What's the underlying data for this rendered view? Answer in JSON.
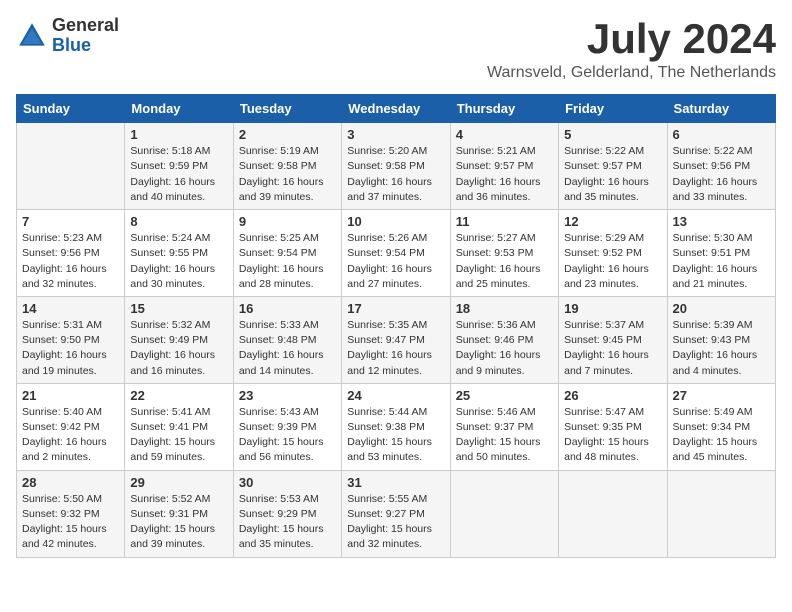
{
  "header": {
    "logo_general": "General",
    "logo_blue": "Blue",
    "month": "July 2024",
    "location": "Warnsveld, Gelderland, The Netherlands"
  },
  "weekdays": [
    "Sunday",
    "Monday",
    "Tuesday",
    "Wednesday",
    "Thursday",
    "Friday",
    "Saturday"
  ],
  "weeks": [
    [
      {
        "day": "",
        "info": ""
      },
      {
        "day": "1",
        "info": "Sunrise: 5:18 AM\nSunset: 9:59 PM\nDaylight: 16 hours\nand 40 minutes."
      },
      {
        "day": "2",
        "info": "Sunrise: 5:19 AM\nSunset: 9:58 PM\nDaylight: 16 hours\nand 39 minutes."
      },
      {
        "day": "3",
        "info": "Sunrise: 5:20 AM\nSunset: 9:58 PM\nDaylight: 16 hours\nand 37 minutes."
      },
      {
        "day": "4",
        "info": "Sunrise: 5:21 AM\nSunset: 9:57 PM\nDaylight: 16 hours\nand 36 minutes."
      },
      {
        "day": "5",
        "info": "Sunrise: 5:22 AM\nSunset: 9:57 PM\nDaylight: 16 hours\nand 35 minutes."
      },
      {
        "day": "6",
        "info": "Sunrise: 5:22 AM\nSunset: 9:56 PM\nDaylight: 16 hours\nand 33 minutes."
      }
    ],
    [
      {
        "day": "7",
        "info": "Sunrise: 5:23 AM\nSunset: 9:56 PM\nDaylight: 16 hours\nand 32 minutes."
      },
      {
        "day": "8",
        "info": "Sunrise: 5:24 AM\nSunset: 9:55 PM\nDaylight: 16 hours\nand 30 minutes."
      },
      {
        "day": "9",
        "info": "Sunrise: 5:25 AM\nSunset: 9:54 PM\nDaylight: 16 hours\nand 28 minutes."
      },
      {
        "day": "10",
        "info": "Sunrise: 5:26 AM\nSunset: 9:54 PM\nDaylight: 16 hours\nand 27 minutes."
      },
      {
        "day": "11",
        "info": "Sunrise: 5:27 AM\nSunset: 9:53 PM\nDaylight: 16 hours\nand 25 minutes."
      },
      {
        "day": "12",
        "info": "Sunrise: 5:29 AM\nSunset: 9:52 PM\nDaylight: 16 hours\nand 23 minutes."
      },
      {
        "day": "13",
        "info": "Sunrise: 5:30 AM\nSunset: 9:51 PM\nDaylight: 16 hours\nand 21 minutes."
      }
    ],
    [
      {
        "day": "14",
        "info": "Sunrise: 5:31 AM\nSunset: 9:50 PM\nDaylight: 16 hours\nand 19 minutes."
      },
      {
        "day": "15",
        "info": "Sunrise: 5:32 AM\nSunset: 9:49 PM\nDaylight: 16 hours\nand 16 minutes."
      },
      {
        "day": "16",
        "info": "Sunrise: 5:33 AM\nSunset: 9:48 PM\nDaylight: 16 hours\nand 14 minutes."
      },
      {
        "day": "17",
        "info": "Sunrise: 5:35 AM\nSunset: 9:47 PM\nDaylight: 16 hours\nand 12 minutes."
      },
      {
        "day": "18",
        "info": "Sunrise: 5:36 AM\nSunset: 9:46 PM\nDaylight: 16 hours\nand 9 minutes."
      },
      {
        "day": "19",
        "info": "Sunrise: 5:37 AM\nSunset: 9:45 PM\nDaylight: 16 hours\nand 7 minutes."
      },
      {
        "day": "20",
        "info": "Sunrise: 5:39 AM\nSunset: 9:43 PM\nDaylight: 16 hours\nand 4 minutes."
      }
    ],
    [
      {
        "day": "21",
        "info": "Sunrise: 5:40 AM\nSunset: 9:42 PM\nDaylight: 16 hours\nand 2 minutes."
      },
      {
        "day": "22",
        "info": "Sunrise: 5:41 AM\nSunset: 9:41 PM\nDaylight: 15 hours\nand 59 minutes."
      },
      {
        "day": "23",
        "info": "Sunrise: 5:43 AM\nSunset: 9:39 PM\nDaylight: 15 hours\nand 56 minutes."
      },
      {
        "day": "24",
        "info": "Sunrise: 5:44 AM\nSunset: 9:38 PM\nDaylight: 15 hours\nand 53 minutes."
      },
      {
        "day": "25",
        "info": "Sunrise: 5:46 AM\nSunset: 9:37 PM\nDaylight: 15 hours\nand 50 minutes."
      },
      {
        "day": "26",
        "info": "Sunrise: 5:47 AM\nSunset: 9:35 PM\nDaylight: 15 hours\nand 48 minutes."
      },
      {
        "day": "27",
        "info": "Sunrise: 5:49 AM\nSunset: 9:34 PM\nDaylight: 15 hours\nand 45 minutes."
      }
    ],
    [
      {
        "day": "28",
        "info": "Sunrise: 5:50 AM\nSunset: 9:32 PM\nDaylight: 15 hours\nand 42 minutes."
      },
      {
        "day": "29",
        "info": "Sunrise: 5:52 AM\nSunset: 9:31 PM\nDaylight: 15 hours\nand 39 minutes."
      },
      {
        "day": "30",
        "info": "Sunrise: 5:53 AM\nSunset: 9:29 PM\nDaylight: 15 hours\nand 35 minutes."
      },
      {
        "day": "31",
        "info": "Sunrise: 5:55 AM\nSunset: 9:27 PM\nDaylight: 15 hours\nand 32 minutes."
      },
      {
        "day": "",
        "info": ""
      },
      {
        "day": "",
        "info": ""
      },
      {
        "day": "",
        "info": ""
      }
    ]
  ]
}
